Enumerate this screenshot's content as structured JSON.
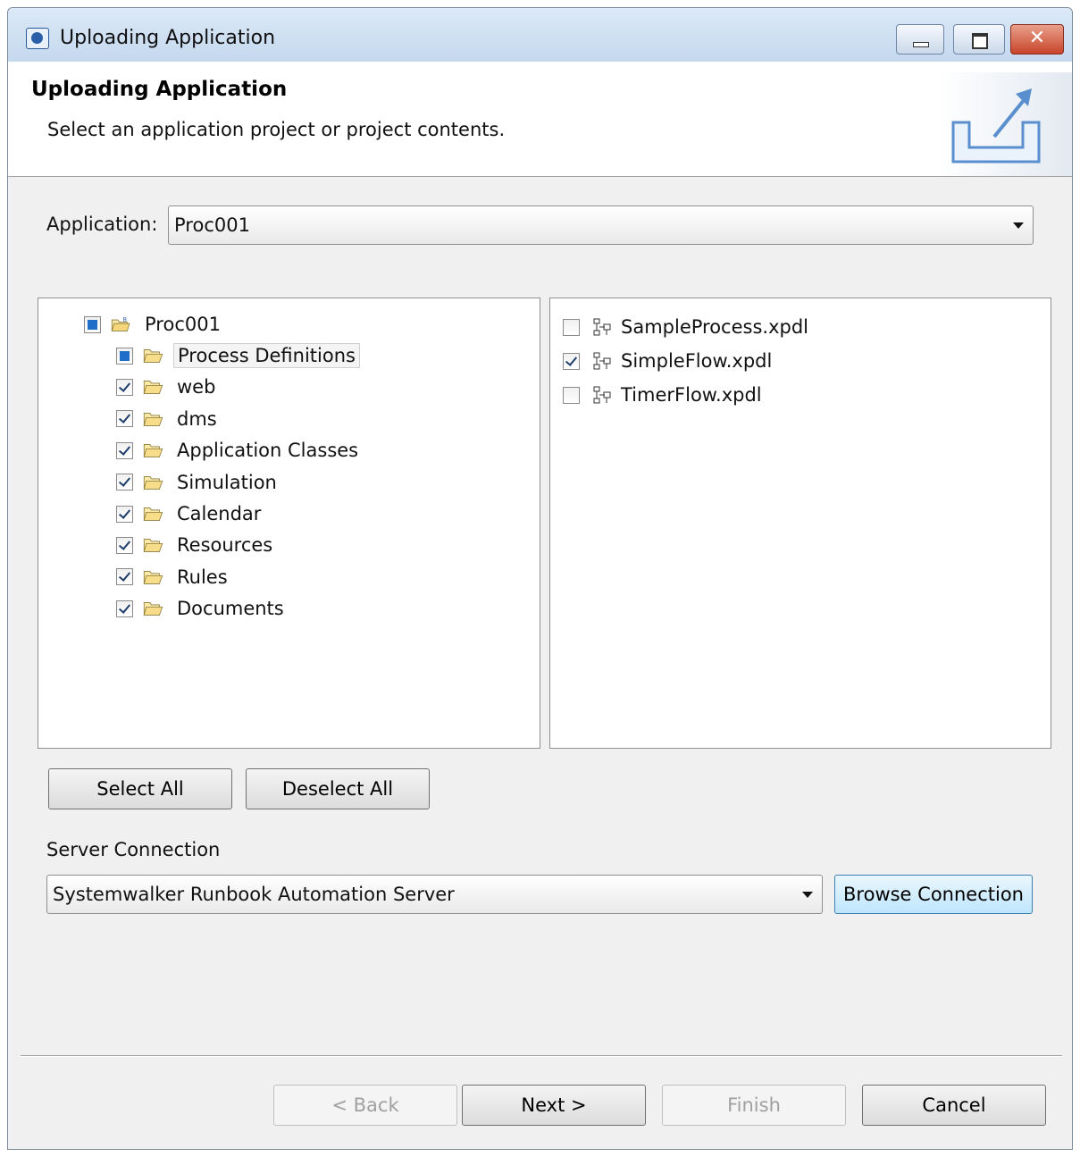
{
  "window": {
    "title": "Uploading Application",
    "close_glyph": "✕"
  },
  "header": {
    "title": "Uploading Application",
    "description": "Select an application project or project contents."
  },
  "application": {
    "label": "Application:",
    "value": "Proc001"
  },
  "tree": {
    "root": {
      "label": "Proc001",
      "state": "partial"
    },
    "items": [
      {
        "label": "Process Definitions",
        "state": "partial",
        "selected": true
      },
      {
        "label": "web",
        "state": "checked"
      },
      {
        "label": "dms",
        "state": "checked"
      },
      {
        "label": "Application Classes",
        "state": "checked"
      },
      {
        "label": "Simulation",
        "state": "checked"
      },
      {
        "label": "Calendar",
        "state": "checked"
      },
      {
        "label": "Resources",
        "state": "checked"
      },
      {
        "label": "Rules",
        "state": "checked"
      },
      {
        "label": "Documents",
        "state": "checked"
      }
    ]
  },
  "files": [
    {
      "label": "SampleProcess.xpdl",
      "checked": false
    },
    {
      "label": "SimpleFlow.xpdl",
      "checked": true
    },
    {
      "label": "TimerFlow.xpdl",
      "checked": false
    }
  ],
  "buttons": {
    "select_all": "Select All",
    "deselect_all": "Deselect All"
  },
  "server": {
    "label": "Server Connection",
    "value": "Systemwalker Runbook Automation Server",
    "browse": "Browse Connection"
  },
  "footer": {
    "back": "< Back",
    "next": "Next >",
    "finish": "Finish",
    "cancel": "Cancel"
  }
}
